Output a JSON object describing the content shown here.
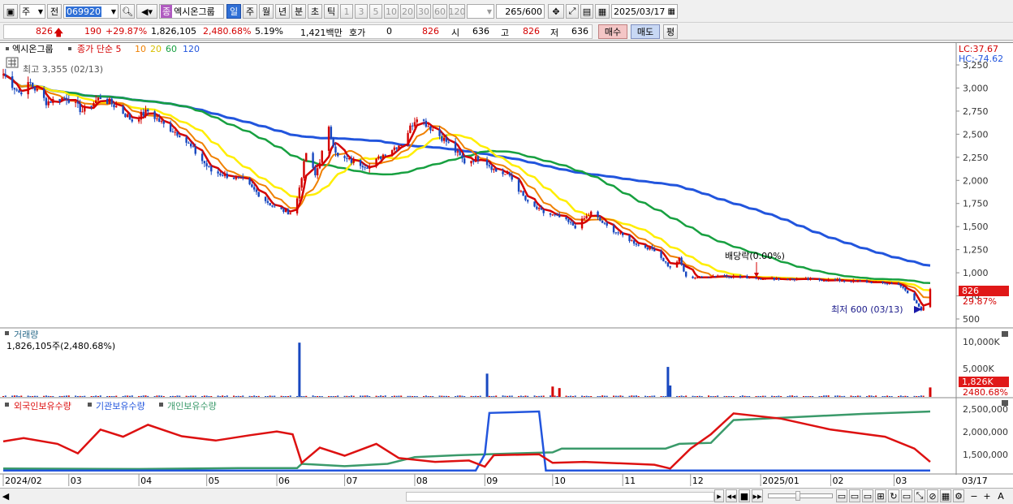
{
  "toolbar": {
    "period_select": "주",
    "compare_button": "전",
    "code_input": "069920",
    "company_badge": "종",
    "company_name": "엑시온그룹",
    "periods": [
      "일",
      "주",
      "월",
      "년",
      "분",
      "초",
      "틱"
    ],
    "active_period": "일",
    "intervals": [
      "1",
      "3",
      "5",
      "10",
      "20",
      "30",
      "60",
      "120"
    ],
    "count_current": "265",
    "count_total": "/600",
    "date_value": "2025/03/17"
  },
  "quote": {
    "price": "826",
    "change": "190",
    "change_pct": "+29.87%",
    "volume": "1,826,105",
    "volume_ratio": "2,480.68%",
    "turnover": "5.19%",
    "amount": "1,421백만",
    "bid_label": "호가",
    "bid_value": "0",
    "ask_value": "826",
    "open_label": "시",
    "open_value": "636",
    "high_label": "고",
    "high_value": "826",
    "low_label": "저",
    "low_value": "636",
    "buy_button": "매수",
    "sell_button": "매도",
    "eval_button": "평"
  },
  "chart_data": [
    {
      "type": "candlestick",
      "title": "엑시온그룹",
      "legend": [
        "종가 단순 5",
        "10",
        "20",
        "60",
        "120"
      ],
      "series": [
        {
          "name": "종가 단순 5",
          "color": "#d40000"
        },
        {
          "name": "10",
          "color": "#f08000"
        },
        {
          "name": "20",
          "color": "#ffee00"
        },
        {
          "name": "60",
          "color": "#17a040"
        },
        {
          "name": "120",
          "color": "#2255dd"
        }
      ],
      "ylim": [
        500,
        3250
      ],
      "yticks": [
        500,
        750,
        "1,000",
        "1,250",
        "1,500",
        "1,750",
        "2,000",
        "2,250",
        "2,500",
        "2,750",
        "3,000",
        "3,250"
      ],
      "price_path": [
        [
          "2024-02-01",
          3150
        ],
        [
          "2024-02-08",
          2950
        ],
        [
          "2024-02-13",
          3050
        ],
        [
          "2024-02-20",
          2850
        ],
        [
          "2024-02-29",
          2900
        ],
        [
          "2024-03-07",
          2750
        ],
        [
          "2024-03-15",
          2900
        ],
        [
          "2024-03-22",
          2800
        ],
        [
          "2024-03-29",
          2650
        ],
        [
          "2024-04-05",
          2750
        ],
        [
          "2024-04-12",
          2600
        ],
        [
          "2024-04-19",
          2500
        ],
        [
          "2024-04-26",
          2300
        ],
        [
          "2024-05-03",
          2100
        ],
        [
          "2024-05-10",
          2050
        ],
        [
          "2024-05-17",
          2000
        ],
        [
          "2024-05-24",
          1850
        ],
        [
          "2024-05-31",
          1700
        ],
        [
          "2024-06-07",
          1650
        ],
        [
          "2024-06-10",
          1800
        ],
        [
          "2024-06-14",
          2300
        ],
        [
          "2024-06-18",
          2050
        ],
        [
          "2024-06-24",
          2550
        ],
        [
          "2024-06-28",
          2250
        ],
        [
          "2024-07-05",
          2200
        ],
        [
          "2024-07-12",
          2150
        ],
        [
          "2024-07-19",
          2300
        ],
        [
          "2024-07-26",
          2400
        ],
        [
          "2024-08-02",
          2700
        ],
        [
          "2024-08-09",
          2550
        ],
        [
          "2024-08-16",
          2400
        ],
        [
          "2024-08-23",
          2200
        ],
        [
          "2024-08-30",
          2250
        ],
        [
          "2024-09-06",
          2100
        ],
        [
          "2024-09-12",
          2050
        ],
        [
          "2024-09-20",
          1750
        ],
        [
          "2024-09-27",
          1650
        ],
        [
          "2024-10-04",
          1600
        ],
        [
          "2024-10-11",
          1500
        ],
        [
          "2024-10-18",
          1650
        ],
        [
          "2024-10-25",
          1500
        ],
        [
          "2024-11-01",
          1400
        ],
        [
          "2024-11-08",
          1300
        ],
        [
          "2024-11-15",
          1250
        ],
        [
          "2024-11-22",
          1050
        ],
        [
          "2024-11-26",
          1150
        ],
        [
          "2024-11-29",
          950
        ],
        [
          "2024-12-06",
          950
        ],
        [
          "2024-12-13",
          970
        ],
        [
          "2024-12-20",
          960
        ],
        [
          "2025-01-03",
          940
        ],
        [
          "2025-01-17",
          930
        ],
        [
          "2025-02-03",
          920
        ],
        [
          "2025-02-17",
          900
        ],
        [
          "2025-03-03",
          880
        ],
        [
          "2025-03-10",
          700
        ],
        [
          "2025-03-13",
          600
        ],
        [
          "2025-03-14",
          636
        ],
        [
          "2025-03-17",
          826
        ]
      ],
      "annotations": [
        "최고 3,355 (02/13)",
        "최저 600 (03/13)",
        "배당락(0.00%)"
      ],
      "right_labels": {
        "lc": "LC:37.67",
        "hc": "HC:-74.62",
        "price": "826",
        "pct": "29.87%"
      }
    },
    {
      "type": "bar",
      "title": "거래량",
      "subtitle": "1,826,105주(2,480.68%)",
      "yticks": [
        "5,000K",
        "10,000K"
      ],
      "last_label": "1,826K",
      "last_pct": "2480.68%",
      "spikes": [
        [
          "2024-06-11",
          10500
        ],
        [
          "2024-09-02",
          4500
        ],
        [
          "2024-10-01",
          2000
        ],
        [
          "2024-10-04",
          1700
        ],
        [
          "2024-11-21",
          5800
        ],
        [
          "2024-11-22",
          2200
        ],
        [
          "2025-03-17",
          1826
        ]
      ],
      "base_volume": 200
    },
    {
      "type": "line",
      "series": [
        {
          "name": "외국인보유수량",
          "color": "#dd1111"
        },
        {
          "name": "기관보유수량",
          "color": "#2255dd"
        },
        {
          "name": "개인보유수량",
          "color": "#3a9a6a"
        }
      ],
      "yticks": [
        "1,500,000",
        "2,000,000",
        "2,500,000"
      ]
    }
  ],
  "xaxis": {
    "labels": [
      "2024/02",
      "03",
      "04",
      "05",
      "06",
      "07",
      "08",
      "09",
      "10",
      "11",
      "12",
      "2025/01",
      "02",
      "03"
    ],
    "right_label": "03/17"
  }
}
